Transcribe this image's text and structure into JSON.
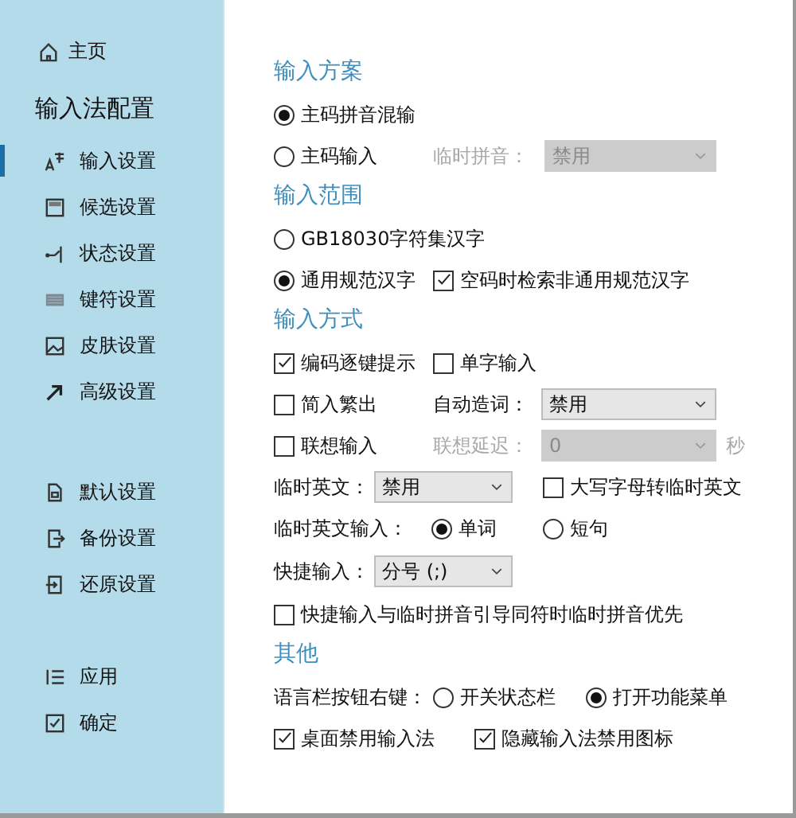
{
  "sidebar": {
    "home": "主页",
    "title": "输入法配置",
    "nav": [
      {
        "label": "输入设置",
        "selected": true
      },
      {
        "label": "候选设置",
        "selected": false
      },
      {
        "label": "状态设置",
        "selected": false
      },
      {
        "label": "键符设置",
        "selected": false
      },
      {
        "label": "皮肤设置",
        "selected": false
      },
      {
        "label": "高级设置",
        "selected": false
      }
    ],
    "actions": [
      {
        "label": "默认设置"
      },
      {
        "label": "备份设置"
      },
      {
        "label": "还原设置"
      }
    ],
    "buttons": [
      {
        "label": "应用"
      },
      {
        "label": "确定"
      }
    ]
  },
  "input_scheme": {
    "heading": "输入方案",
    "mixed": {
      "label": "主码拼音混输",
      "selected": true
    },
    "main_only": {
      "label": "主码输入",
      "selected": false
    },
    "temp_pinyin": {
      "label": "临时拼音：",
      "value": "禁用",
      "disabled": true
    }
  },
  "input_range": {
    "heading": "输入范围",
    "options": [
      {
        "label": "GB18030字符集汉字",
        "selected": false
      },
      {
        "label": "通用规范汉字",
        "selected": true
      }
    ],
    "search_nonstandard": {
      "label": "空码时检索非通用规范汉字",
      "checked": true
    }
  },
  "input_method": {
    "heading": "输入方式",
    "code_hint": {
      "label": "编码逐键提示",
      "checked": true
    },
    "single_char": {
      "label": "单字输入",
      "checked": false
    },
    "simp_to_trad": {
      "label": "简入繁出",
      "checked": false
    },
    "auto_word": {
      "label": "自动造词：",
      "value": "禁用",
      "disabled": false
    },
    "association": {
      "label": "联想输入",
      "checked": false
    },
    "association_delay": {
      "label": "联想延迟：",
      "value": "0",
      "unit": "秒",
      "disabled": true
    },
    "temp_english": {
      "label": "临时英文：",
      "value": "禁用"
    },
    "uppercase_temp_english": {
      "label": "大写字母转临时英文",
      "checked": false
    },
    "temp_english_input": {
      "label": "临时英文输入：",
      "options": [
        {
          "label": "单词",
          "selected": true
        },
        {
          "label": "短句",
          "selected": false
        }
      ]
    },
    "quick_input": {
      "label": "快捷输入：",
      "value": "分号 (;)"
    },
    "quick_priority": {
      "label": "快捷输入与临时拼音引导同符时临时拼音优先",
      "checked": false
    }
  },
  "other": {
    "heading": "其他",
    "langbar_right_click": {
      "label": "语言栏按钮右键：",
      "options": [
        {
          "label": "开关状态栏",
          "selected": false
        },
        {
          "label": "打开功能菜单",
          "selected": true
        }
      ]
    },
    "disable_on_desktop": {
      "label": "桌面禁用输入法",
      "checked": true
    },
    "hide_disabled_icon": {
      "label": "隐藏输入法禁用图标",
      "checked": true
    }
  }
}
